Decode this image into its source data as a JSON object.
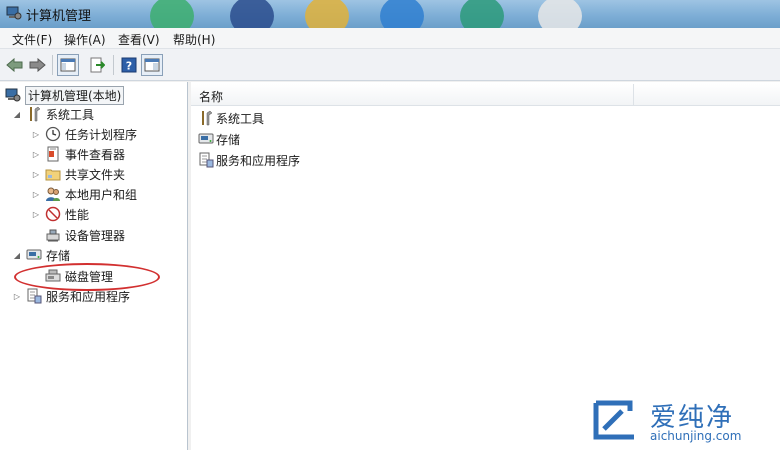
{
  "window": {
    "title": "计算机管理"
  },
  "menu": [
    "文件(F)",
    "操作(A)",
    "查看(V)",
    "帮助(H)"
  ],
  "toolbar": {
    "buttons": [
      "back-icon",
      "forward-icon",
      "console-tree-icon",
      "export-list-icon",
      "help-icon",
      "properties-icon"
    ]
  },
  "tree": {
    "root": "计算机管理(本地)",
    "system_tools": "系统工具",
    "task_scheduler": "任务计划程序",
    "event_viewer": "事件查看器",
    "shared_folders": "共享文件夹",
    "local_users": "本地用户和组",
    "performance": "性能",
    "device_manager": "设备管理器",
    "storage": "存储",
    "disk_management": "磁盘管理",
    "services_apps": "服务和应用程序"
  },
  "list": {
    "column_name": "名称",
    "items": [
      "系统工具",
      "存储",
      "服务和应用程序"
    ]
  },
  "watermark": {
    "brand": "爱纯净",
    "url": "aichunjing.com"
  },
  "colors": {
    "highlight": "#d23030",
    "watermark": "#2f6fb8"
  }
}
